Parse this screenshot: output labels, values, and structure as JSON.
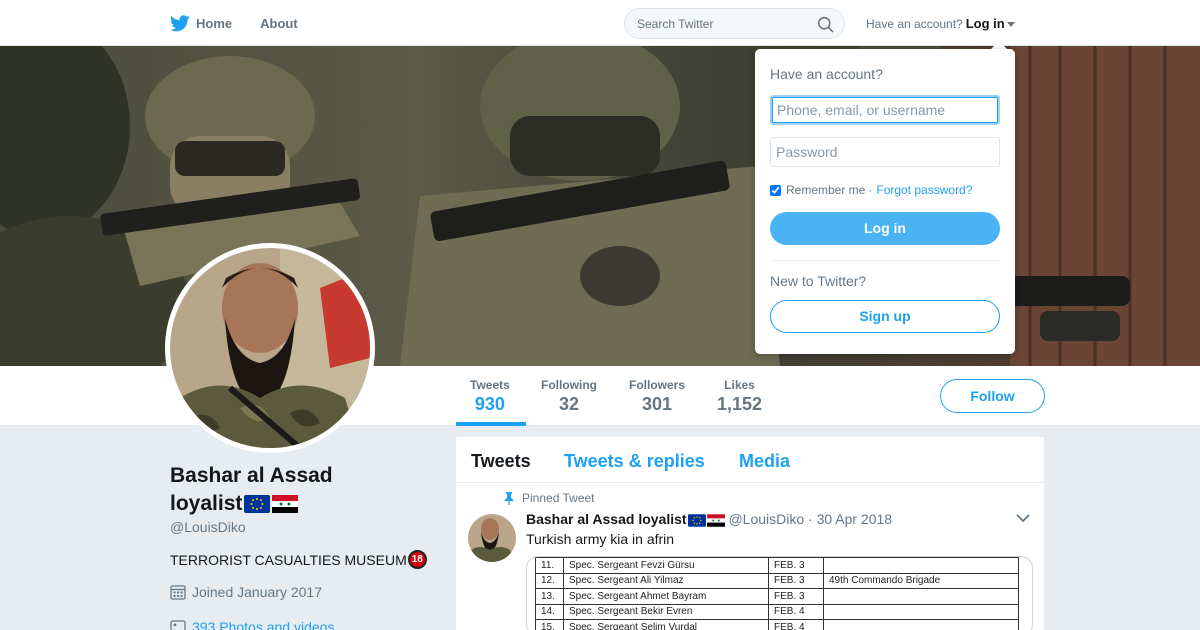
{
  "nav": {
    "home_label": "Home",
    "about_label": "About",
    "search_placeholder": "Search Twitter",
    "have_account": "Have an account?",
    "login_label": "Log in"
  },
  "stats": [
    {
      "label": "Tweets",
      "value": "930"
    },
    {
      "label": "Following",
      "value": "32"
    },
    {
      "label": "Followers",
      "value": "301"
    },
    {
      "label": "Likes",
      "value": "1,152"
    }
  ],
  "follow_label": "Follow",
  "profile": {
    "name_line1": "Bashar al Assad",
    "name_line2": "loyalist",
    "handle": "@LouisDiko",
    "bio": "TERRORIST CASUALTIES MUSEUM",
    "bio_badge": "18",
    "joined": "Joined January 2017",
    "photos": "393 Photos and videos"
  },
  "timeline": {
    "tabs": [
      "Tweets",
      "Tweets & replies",
      "Media"
    ],
    "pinned_label": "Pinned Tweet",
    "tweet": {
      "name": "Bashar al Assad loyalist",
      "handle": "@LouisDiko",
      "date": "· 30 Apr 2018",
      "text": "Turkish army kia in afrin",
      "table_rows": [
        [
          "11.",
          "Spec. Sergeant Fevzi Gürsu",
          "FEB. 3",
          ""
        ],
        [
          "12.",
          "Spec. Sergeant Ali Yilmaz",
          "FEB. 3",
          "49th Commando Brigade"
        ],
        [
          "13.",
          "Spec. Sergeant Ahmet Bayram",
          "FEB. 3",
          ""
        ],
        [
          "14.",
          "Spec. Sergeant Bekir Evren",
          "FEB. 4",
          ""
        ],
        [
          "15.",
          "Spec. Sergeant Selim Vurdal",
          "FEB. 4",
          ""
        ]
      ]
    }
  },
  "dropdown": {
    "title": "Have an account?",
    "username_placeholder": "Phone, email, or username",
    "password_placeholder": "Password",
    "remember": "Remember me",
    "separator": "·",
    "forgot": "Forgot password?",
    "login_button": "Log in",
    "new_to": "New to Twitter?",
    "signup_button": "Sign up"
  },
  "colors": {
    "accent": "#1da1f2",
    "background": "#e6ecf0"
  }
}
